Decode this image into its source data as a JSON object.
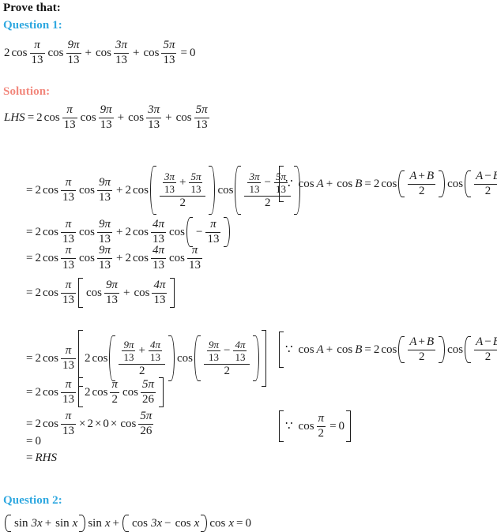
{
  "document": {
    "prompt": "Prove that:",
    "question1_heading": "Question 1:",
    "solution_heading": "Solution:",
    "question2_heading": "Question 2:",
    "colors": {
      "question_heading": "#2fa8e0",
      "solution_heading": "#f2877c",
      "body_text": "#1c1c1c",
      "background": "#ffffff"
    }
  },
  "question1": {
    "statement": {
      "coef": "2",
      "cos": "cos",
      "pi": "π",
      "den13": "13",
      "num9pi": "9π",
      "num3pi": "3π",
      "num5pi": "5π",
      "plus": "+",
      "equals": "=",
      "zero": "0"
    }
  },
  "solution": {
    "lhs_label": "LHS",
    "equals": "=",
    "rhs_label": "RHS",
    "zero": "0",
    "two": "2",
    "den2": "2",
    "den13": "13",
    "den26": "26",
    "pi": "π",
    "num3pi": "3π",
    "num4pi": "4π",
    "num5pi": "5π",
    "num9pi": "9π",
    "cos": "cos",
    "plus": "+",
    "minus": "−",
    "times": "×",
    "because": "∵",
    "identity": {
      "cosA": "cos",
      "A": "A",
      "B": "B",
      "plus": "+",
      "minus": "−",
      "equals": "=",
      "two": "2",
      "den2": "2"
    },
    "note_cos_half_pi": {
      "because": "∵",
      "cos": "cos",
      "pi": "π",
      "den2": "2",
      "equals": "=",
      "zero": "0"
    }
  },
  "question2": {
    "statement": {
      "lparen": "(",
      "rparen": ")",
      "sin": "sin",
      "cos": "cos",
      "three_x": "3x",
      "x": "x",
      "plus": "+",
      "minus": "−",
      "equals": "=",
      "zero": "0"
    }
  }
}
